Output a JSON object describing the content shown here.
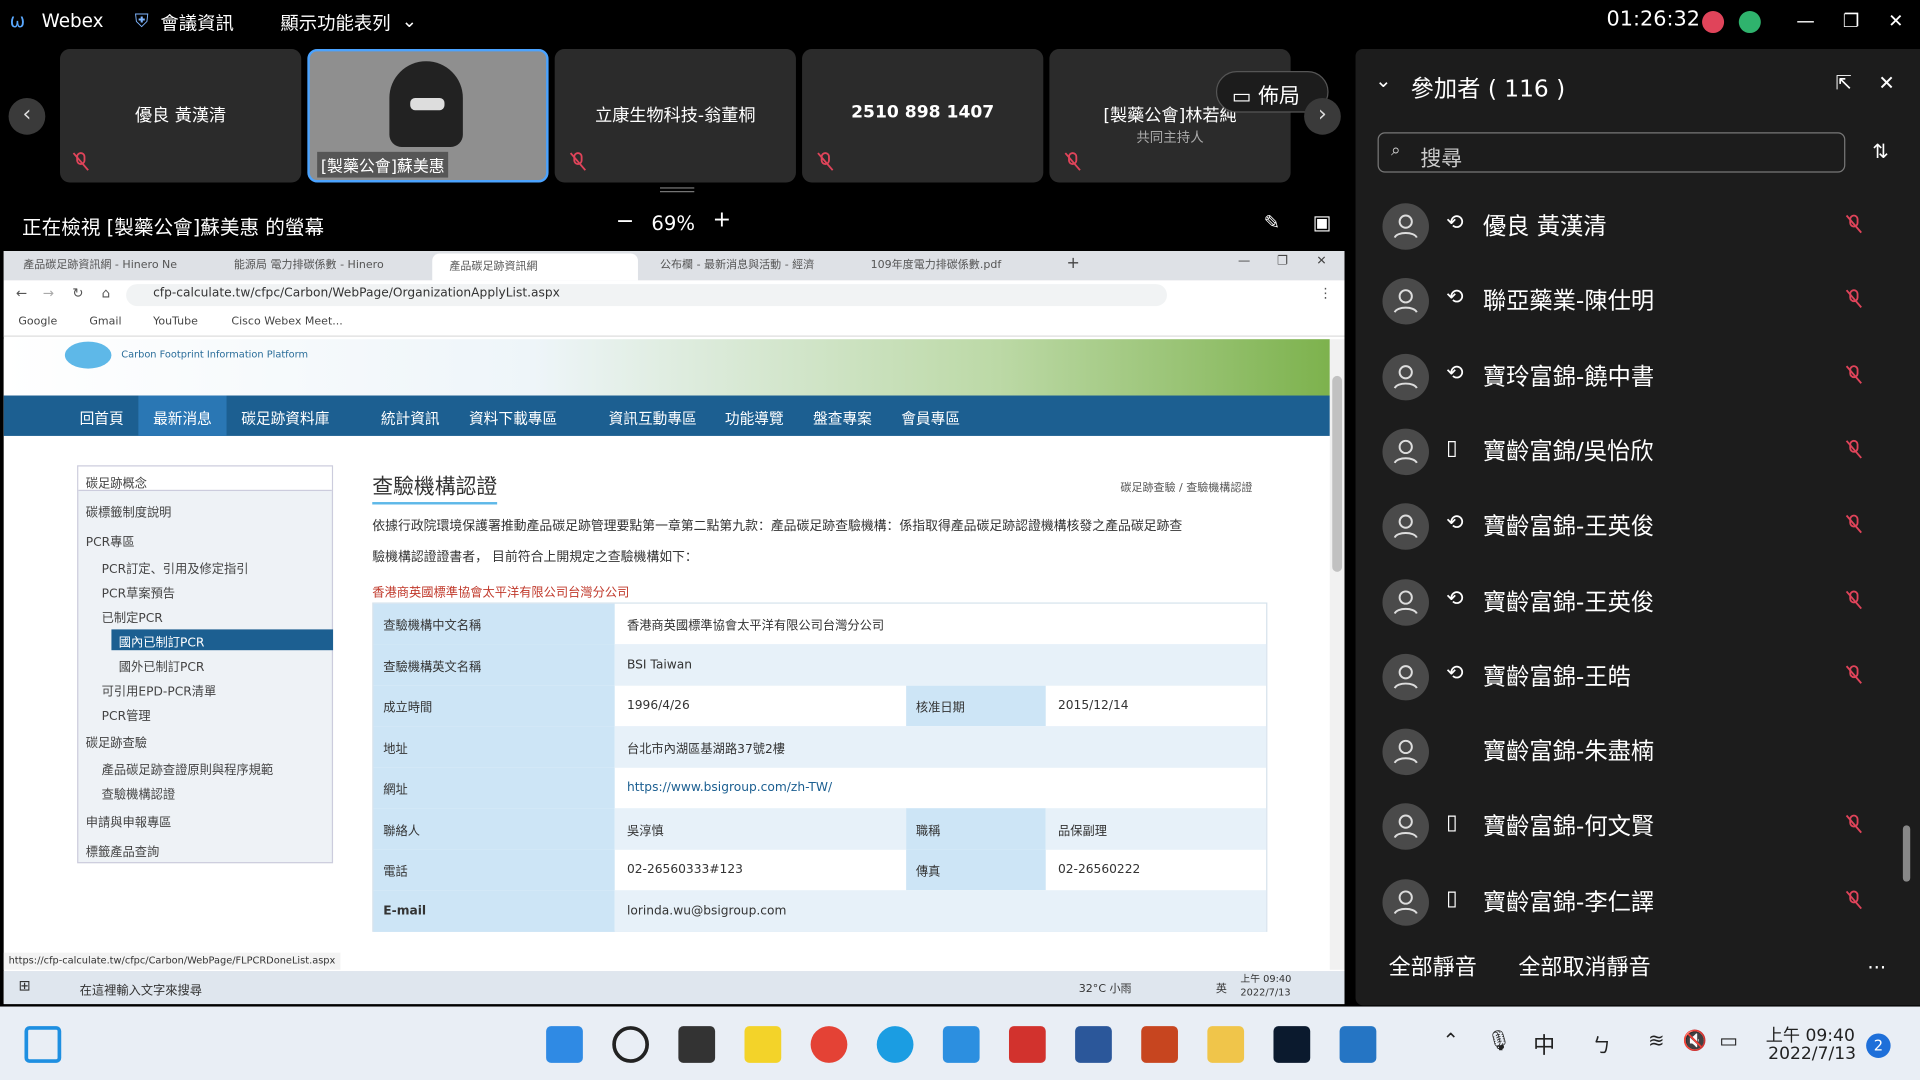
{
  "app": {
    "name": "Webex",
    "meeting_info": "會議資訊",
    "menu": "顯示功能表列",
    "time": "01:26:32"
  },
  "thumbnails": [
    {
      "name": "優良 黃漢清",
      "sub": ""
    },
    {
      "name": "[製藥公會]蘇美惠",
      "sub": ""
    },
    {
      "name": "立康生物科技-翁董桐",
      "sub": ""
    },
    {
      "name": "2510 898 1407",
      "sub": ""
    },
    {
      "name": "[製藥公會]林若純",
      "sub": "共同主持人"
    }
  ],
  "layout_button": "佈局",
  "viewing": {
    "label": "正在檢視 [製藥公會]蘇美惠 的螢幕",
    "zoom": "69%"
  },
  "participants": {
    "title": "參加者 ( 116 )",
    "search_placeholder": "搜尋",
    "list": [
      {
        "name": "優良 黃漢清",
        "device": "headset-icon"
      },
      {
        "name": "聯亞藥業-陳仕明",
        "device": "headset-icon"
      },
      {
        "name": "寶玲富錦-饒中書",
        "device": "headset-icon"
      },
      {
        "name": "寶齡富錦/吳怡欣",
        "device": "phone-icon"
      },
      {
        "name": "寶齡富錦-王英俊",
        "device": "headset-icon"
      },
      {
        "name": "寶齡富錦-王英俊",
        "device": "headset-icon"
      },
      {
        "name": "寶齡富錦-王皓",
        "device": "headset-icon"
      },
      {
        "name": "寶齡富錦-朱盡楠",
        "device": ""
      },
      {
        "name": "寶齡富錦-何文賢",
        "device": "phone-icon"
      },
      {
        "name": "寶齡富錦-李仁譯",
        "device": "phone-icon"
      }
    ],
    "mute_all": "全部靜音",
    "unmute_all": "全部取消靜音",
    "more": "..."
  },
  "browser": {
    "tabs": [
      "產品碳足跡資訊網 - Hinero Ne",
      "能源局 電力排碳係數 - Hinero",
      "產品碳足跡資訊網",
      "公布欄 - 最新消息與活動 - 經濟",
      "109年度電力排碳係數.pdf"
    ],
    "url": "cfp-calculate.tw/cfpc/Carbon/WebPage/OrganizationApplyList.aspx",
    "bookmarks": [
      "Google",
      "Gmail",
      "YouTube",
      "Cisco Webex Meet..."
    ],
    "status_url": "https://cfp-calculate.tw/cfpc/Carbon/WebPage/FLPCRDoneList.aspx"
  },
  "site": {
    "logo_text": "Carbon Footprint Information Platform",
    "nav": [
      "回首頁",
      "最新消息",
      "碳足跡資料庫",
      "統計資訊",
      "資料下載專區",
      "資訊互動專區",
      "功能導覽",
      "盤查專案",
      "會員專區"
    ],
    "sidebar": [
      "碳足跡概念",
      "碳標籤制度說明",
      "PCR專區",
      "PCR訂定、引用及修定指引",
      "PCR草案預告",
      "已制定PCR",
      "國內已制訂PCR",
      "國外已制訂PCR",
      "可引用EPD-PCR清單",
      "PCR管理",
      "碳足跡查驗",
      "產品碳足跡查證原則與程序規範",
      "查驗機構認證",
      "申請與申報專區",
      "標籤產品查詢"
    ],
    "page_title": "查驗機構認證",
    "breadcrumb": "碳足跡查驗 / 查驗機構認證",
    "intro1": "依據行政院環境保護署推動產品碳足跡管理要點第一章第二點第九款：產品碳足跡查驗機構：係指取得產品碳足跡認證機構核發之產品碳足跡查",
    "intro2": "驗機構認證證書者， 目前符合上開規定之查驗機構如下：",
    "org_title": "香港商英國標準協會太平洋有限公司台灣分公司",
    "table": {
      "cn_name_label": "查驗機構中文名稱",
      "cn_name": "香港商英國標準協會太平洋有限公司台灣分公司",
      "en_name_label": "查驗機構英文名稱",
      "en_name": "BSI Taiwan",
      "est_label": "成立時間",
      "est": "1996/4/26",
      "approve_label": "核准日期",
      "approve": "2015/12/14",
      "addr_label": "地址",
      "addr": "台北市內湖區基湖路37號2樓",
      "web_label": "網址",
      "web": "https://www.bsigroup.com/zh-TW/",
      "contact_label": "聯絡人",
      "contact": "吳淳慎",
      "title_label": "職稱",
      "title": "品保副理",
      "tel_label": "電話",
      "tel": "02-26560333#123",
      "fax_label": "傳真",
      "fax": "02-26560222",
      "email_label": "E-mail",
      "email": "lorinda.wu@bsigroup.com"
    }
  },
  "inner_taskbar": {
    "search": "在這裡輸入文字來搜尋",
    "weather": "32°C 小雨",
    "ime": "英",
    "time": "上午 09:40",
    "date": "2022/7/13"
  },
  "taskbar": {
    "ime": "中",
    "time": "上午 09:40",
    "date": "2022/7/13",
    "badge": "2"
  }
}
